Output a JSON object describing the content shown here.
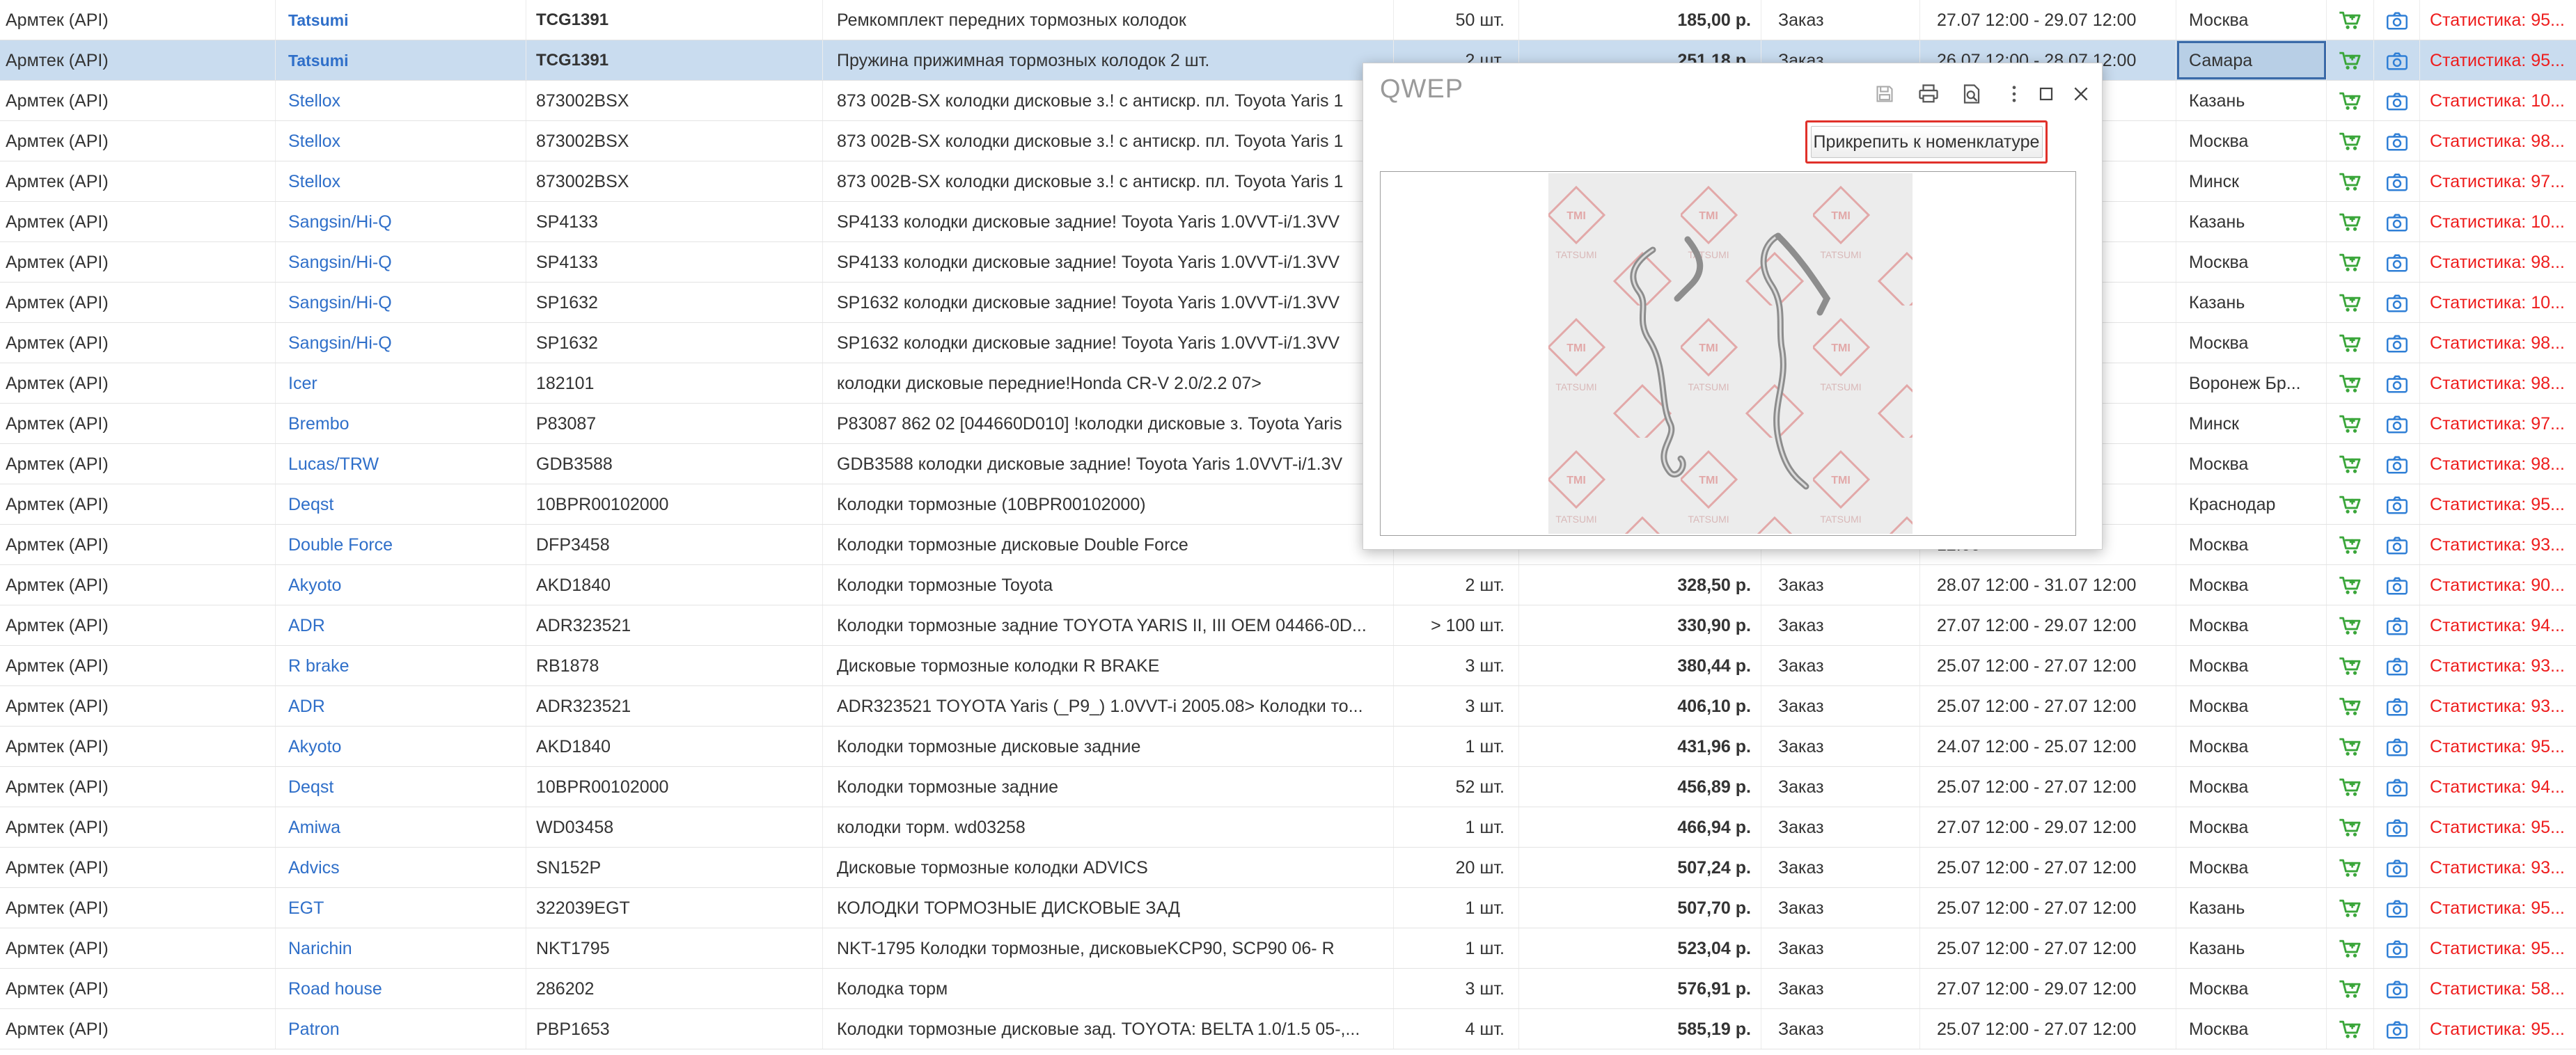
{
  "rows": [
    {
      "source": "Армтек (API)",
      "brand": "Tatsumi",
      "article": "TCG1391",
      "description": "Ремкомплект передних тормозных колодок",
      "qty": "50 шт.",
      "price": "185,00 р.",
      "kind": "Заказ",
      "term": "27.07 12:00 - 29.07 12:00",
      "city": "Москва",
      "stat": "Статистика: 95...",
      "bold_brand": true,
      "bold_article": true
    },
    {
      "source": "Армтек (API)",
      "brand": "Tatsumi",
      "article": "TCG1391",
      "description": "Пружина прижимная тормозных колодок 2 шт.",
      "qty": "2 шт.",
      "price": "251,18 р.",
      "kind": "Заказ",
      "term": "26.07 12:00 - 28.07 12:00",
      "city": "Самара",
      "stat": "Статистика: 95...",
      "bold_brand": true,
      "bold_article": true,
      "selected": true
    },
    {
      "source": "Армтек (API)",
      "brand": "Stellox",
      "article": "873002BSX",
      "description": "873 002B-SX колодки дисковые з.! с антискр. пл. Toyota Yaris 1",
      "qty": "",
      "price": "",
      "kind": "",
      "term": "",
      "city": "Казань",
      "stat": "Статистика: 10..."
    },
    {
      "source": "Армтек (API)",
      "brand": "Stellox",
      "article": "873002BSX",
      "description": "873 002B-SX колодки дисковые з.! с антискр. пл. Toyota Yaris 1",
      "qty": "",
      "price": "",
      "kind": "",
      "term": "",
      "city": "Москва",
      "stat": "Статистика: 98..."
    },
    {
      "source": "Армтек (API)",
      "brand": "Stellox",
      "article": "873002BSX",
      "description": "873 002B-SX колодки дисковые з.! с антискр. пл. Toyota Yaris 1",
      "qty": "",
      "price": "",
      "kind": "",
      "term": "",
      "city": "Минск",
      "stat": "Статистика: 97..."
    },
    {
      "source": "Армтек (API)",
      "brand": "Sangsin/Hi-Q",
      "article": "SP4133",
      "description": "SP4133 колодки дисковые задние! Toyota Yaris 1.0VVT-i/1.3VV",
      "qty": "",
      "price": "",
      "kind": "",
      "term": "",
      "city": "Казань",
      "stat": "Статистика: 10..."
    },
    {
      "source": "Армтек (API)",
      "brand": "Sangsin/Hi-Q",
      "article": "SP4133",
      "description": "SP4133 колодки дисковые задние! Toyota Yaris 1.0VVT-i/1.3VV",
      "qty": "",
      "price": "",
      "kind": "",
      "term": "",
      "city": "Москва",
      "stat": "Статистика: 98..."
    },
    {
      "source": "Армтек (API)",
      "brand": "Sangsin/Hi-Q",
      "article": "SP1632",
      "description": "SP1632 колодки дисковые задние! Toyota Yaris 1.0VVT-i/1.3VV",
      "qty": "",
      "price": "",
      "kind": "",
      "term": "",
      "city": "Казань",
      "stat": "Статистика: 10..."
    },
    {
      "source": "Армтек (API)",
      "brand": "Sangsin/Hi-Q",
      "article": "SP1632",
      "description": "SP1632 колодки дисковые задние! Toyota Yaris 1.0VVT-i/1.3VV",
      "qty": "",
      "price": "",
      "kind": "",
      "term": "",
      "city": "Москва",
      "stat": "Статистика: 98..."
    },
    {
      "source": "Армтек (API)",
      "brand": "Icer",
      "article": "182101",
      "description": "колодки дисковые передние!Honda CR-V 2.0/2.2 07>",
      "qty": "",
      "price": "",
      "kind": "",
      "term": "",
      "city": "Воронеж Бр...",
      "stat": "Статистика: 98..."
    },
    {
      "source": "Армтек (API)",
      "brand": "Brembo",
      "article": "P83087",
      "description": "P83087 862 02 [044660D010] !колодки дисковые з. Toyota Yaris",
      "qty": "",
      "price": "",
      "kind": "",
      "term": "",
      "city": "Минск",
      "stat": "Статистика: 97..."
    },
    {
      "source": "Армтек (API)",
      "brand": "Lucas/TRW",
      "article": "GDB3588",
      "description": "GDB3588 колодки дисковые задние! Toyota Yaris 1.0VVT-i/1.3V",
      "qty": "",
      "price": "",
      "kind": "",
      "term": "",
      "city": "Москва",
      "stat": "Статистика: 98..."
    },
    {
      "source": "Армтек (API)",
      "brand": "Deqst",
      "article": "10BPR00102000",
      "description": "Колодки тормозные (10BPR00102000)",
      "qty": "",
      "price": "",
      "kind": "",
      "term": "12:00",
      "city": "Краснодар",
      "stat": "Статистика: 95..."
    },
    {
      "source": "Армтек (API)",
      "brand": "Double Force",
      "article": "DFP3458",
      "description": "Колодки тормозные дисковые Double Force",
      "qty": "",
      "price": "",
      "kind": "",
      "term": "12:00",
      "city": "Москва",
      "stat": "Статистика: 93..."
    },
    {
      "source": "Армтек (API)",
      "brand": "Akyoto",
      "article": "AKD1840",
      "description": "Колодки тормозные Toyota",
      "qty": "2 шт.",
      "price": "328,50 р.",
      "kind": "Заказ",
      "term": "28.07 12:00 - 31.07 12:00",
      "city": "Москва",
      "stat": "Статистика: 90..."
    },
    {
      "source": "Армтек (API)",
      "brand": "ADR",
      "article": "ADR323521",
      "description": "Колодки тормозные задние TOYOTA YARIS II, III OEM 04466-0D...",
      "qty": "> 100 шт.",
      "price": "330,90 р.",
      "kind": "Заказ",
      "term": "27.07 12:00 - 29.07 12:00",
      "city": "Москва",
      "stat": "Статистика: 94..."
    },
    {
      "source": "Армтек (API)",
      "brand": "R brake",
      "article": "RB1878",
      "description": "Дисковые тормозные колодки R BRAKE",
      "qty": "3 шт.",
      "price": "380,44 р.",
      "kind": "Заказ",
      "term": "25.07 12:00 - 27.07 12:00",
      "city": "Москва",
      "stat": "Статистика: 93..."
    },
    {
      "source": "Армтек (API)",
      "brand": "ADR",
      "article": "ADR323521",
      "description": "ADR323521 TOYOTA Yaris (_P9_) 1.0VVT-i 2005.08> Колодки то...",
      "qty": "3 шт.",
      "price": "406,10 р.",
      "kind": "Заказ",
      "term": "25.07 12:00 - 27.07 12:00",
      "city": "Москва",
      "stat": "Статистика: 93..."
    },
    {
      "source": "Армтек (API)",
      "brand": "Akyoto",
      "article": "AKD1840",
      "description": "Колодки тормозные дисковые задние",
      "qty": "1 шт.",
      "price": "431,96 р.",
      "kind": "Заказ",
      "term": "24.07 12:00 - 25.07 12:00",
      "city": "Москва",
      "stat": "Статистика: 95..."
    },
    {
      "source": "Армтек (API)",
      "brand": "Deqst",
      "article": "10BPR00102000",
      "description": "Колодки тормозные задние",
      "qty": "52 шт.",
      "price": "456,89 р.",
      "kind": "Заказ",
      "term": "25.07 12:00 - 27.07 12:00",
      "city": "Москва",
      "stat": "Статистика: 94..."
    },
    {
      "source": "Армтек (API)",
      "brand": "Amiwa",
      "article": "WD03458",
      "description": "колодки торм. wd03258",
      "qty": "1 шт.",
      "price": "466,94 р.",
      "kind": "Заказ",
      "term": "27.07 12:00 - 29.07 12:00",
      "city": "Москва",
      "stat": "Статистика: 95..."
    },
    {
      "source": "Армтек (API)",
      "brand": "Advics",
      "article": "SN152P",
      "description": "Дисковые тормозные колодки ADVICS",
      "qty": "20 шт.",
      "price": "507,24 р.",
      "kind": "Заказ",
      "term": "25.07 12:00 - 27.07 12:00",
      "city": "Москва",
      "stat": "Статистика: 93..."
    },
    {
      "source": "Армтек (API)",
      "brand": "EGT",
      "article": "322039EGT",
      "description": "КОЛОДКИ ТОРМОЗНЫЕ ДИСКОВЫЕ ЗАД",
      "qty": "1 шт.",
      "price": "507,70 р.",
      "kind": "Заказ",
      "term": "25.07 12:00 - 27.07 12:00",
      "city": "Казань",
      "stat": "Статистика: 95..."
    },
    {
      "source": "Армтек (API)",
      "brand": "Narichin",
      "article": "NKT1795",
      "description": "NKT-1795 Колодки тормозные, дисковыеKCP90, SCP90 06- R",
      "qty": "1 шт.",
      "price": "523,04 р.",
      "kind": "Заказ",
      "term": "25.07 12:00 - 27.07 12:00",
      "city": "Казань",
      "stat": "Статистика: 95..."
    },
    {
      "source": "Армтек (API)",
      "brand": "Road house",
      "article": "286202",
      "description": "Колодка торм",
      "qty": "3 шт.",
      "price": "576,91 р.",
      "kind": "Заказ",
      "term": "27.07 12:00 - 29.07 12:00",
      "city": "Москва",
      "stat": "Статистика: 58..."
    },
    {
      "source": "Армтек (API)",
      "brand": "Patron",
      "article": "PBP1653",
      "description": "Колодки тормозные дисковые зад. TOYOTA: BELTA 1.0/1.5 05-,...",
      "qty": "4 шт.",
      "price": "585,19 р.",
      "kind": "Заказ",
      "term": "25.07 12:00 - 27.07 12:00",
      "city": "Москва",
      "stat": "Статистика: 95..."
    }
  ],
  "modal": {
    "title": "QWEP",
    "attach_button": "Прикрепить к номенклатуре",
    "image_watermark": "TMI TATSUMI",
    "tools": [
      "save-icon",
      "print-icon",
      "preview-icon",
      "more-icon",
      "maximize-icon",
      "close-icon"
    ]
  },
  "colors": {
    "link_blue": "#2f6fc9",
    "stat_red": "#ee1c1c",
    "cart_green": "#3aa63a",
    "camera_blue": "#2f7fd6",
    "selected_row": "#c9dcef",
    "highlight_border": "#e0312a"
  }
}
